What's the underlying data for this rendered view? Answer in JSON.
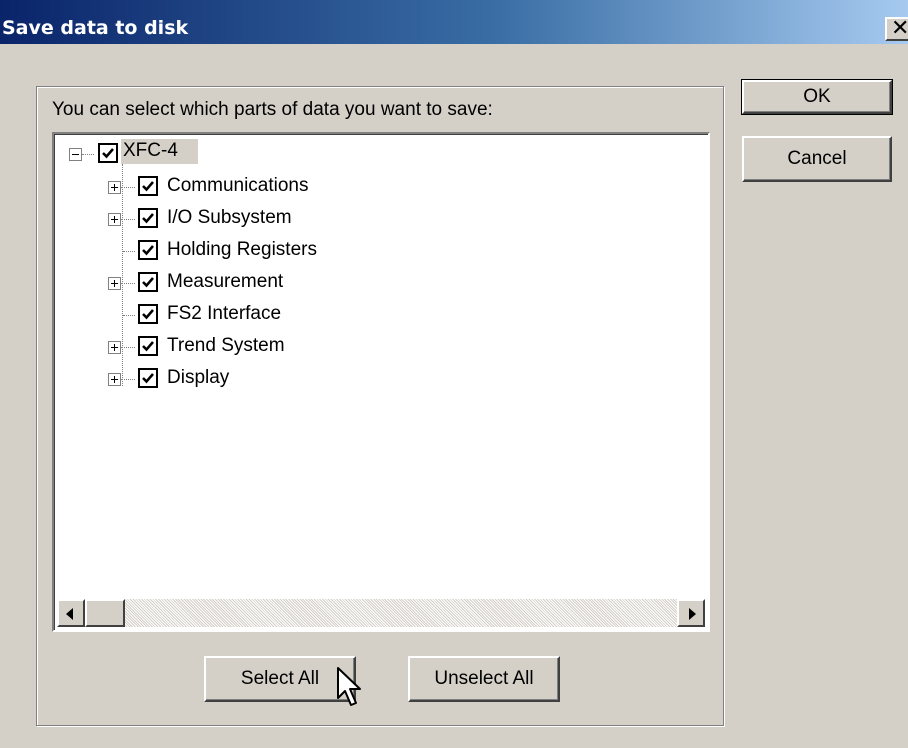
{
  "window": {
    "title": "Save data to disk",
    "close_glyph": "✕"
  },
  "group": {
    "instruction": "You can select which parts of data you want to save:"
  },
  "tree": {
    "root": {
      "label": "XFC-4",
      "checked": true,
      "expanded": true
    },
    "children": [
      {
        "label": "Communications",
        "checked": true,
        "expandable": true
      },
      {
        "label": "I/O Subsystem",
        "checked": true,
        "expandable": true
      },
      {
        "label": "Holding Registers",
        "checked": true,
        "expandable": false
      },
      {
        "label": "Measurement",
        "checked": true,
        "expandable": true
      },
      {
        "label": "FS2 Interface",
        "checked": true,
        "expandable": false
      },
      {
        "label": "Trend System",
        "checked": true,
        "expandable": true
      },
      {
        "label": "Display",
        "checked": true,
        "expandable": true
      }
    ]
  },
  "buttons": {
    "ok": "OK",
    "cancel": "Cancel",
    "select_all": "Select All",
    "unselect_all": "Unselect All"
  },
  "icons": {
    "close": "close-icon",
    "expand": "plus-box-icon",
    "collapse": "minus-box-icon",
    "check": "checkmark-icon",
    "scroll_left": "arrow-left-icon",
    "scroll_right": "arrow-right-icon",
    "cursor": "mouse-pointer-icon"
  },
  "colors": {
    "dialog_bg": "#d4d0c8",
    "title_gradient_start": "#0a246a",
    "title_gradient_end": "#a6caf0"
  }
}
